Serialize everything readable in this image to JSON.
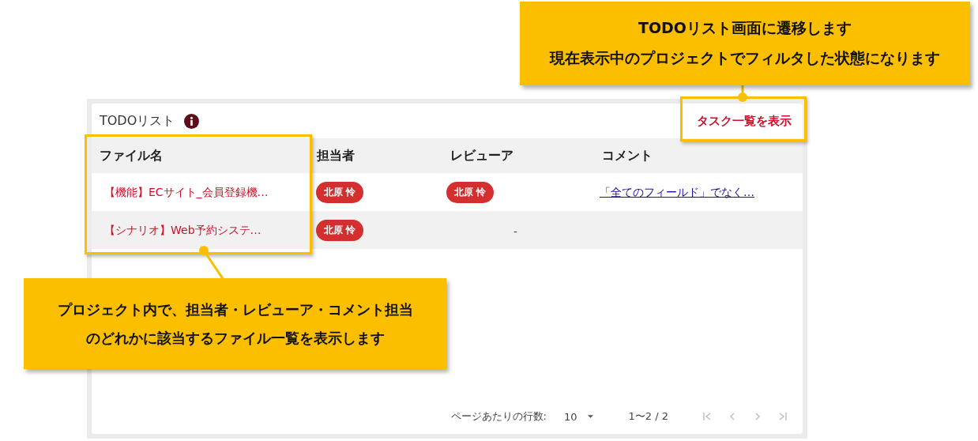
{
  "panel": {
    "title": "TODOリスト",
    "action_link": "タスク一覧を表示"
  },
  "table": {
    "columns": [
      "ファイル名",
      "担当者",
      "レビューア",
      "コメント"
    ],
    "rows": [
      {
        "file": "【機能】ECサイト_会員登録機…",
        "assignee": "北原 怜",
        "reviewer": {
          "kind": "badge",
          "text": "北原 怜"
        },
        "comment": "「全てのフィールド」でなく…"
      },
      {
        "file": "【シナリオ】Web予約システ…",
        "assignee": "北原 怜",
        "reviewer": {
          "kind": "dash",
          "text": "-"
        }
      }
    ]
  },
  "pagination": {
    "rows_per_page_label": "ページあたりの行数:",
    "rows_per_page": "10",
    "range": "1〜2 / 2",
    "buttons": [
      {
        "kind": "first",
        "disabled": true
      },
      {
        "kind": "prev",
        "disabled": true
      },
      {
        "kind": "next",
        "disabled": true
      },
      {
        "kind": "last",
        "disabled": true
      }
    ]
  },
  "callouts": [
    {
      "lines": [
        "TODOリスト画面に遷移します",
        "現在表示中のプロジェクトでフィルタした状態になります"
      ]
    },
    {
      "lines": [
        "プロジェクト内で、担当者・レビューア・コメント担当",
        "のどれかに該当するファイル一覧を表示します"
      ]
    }
  ]
}
